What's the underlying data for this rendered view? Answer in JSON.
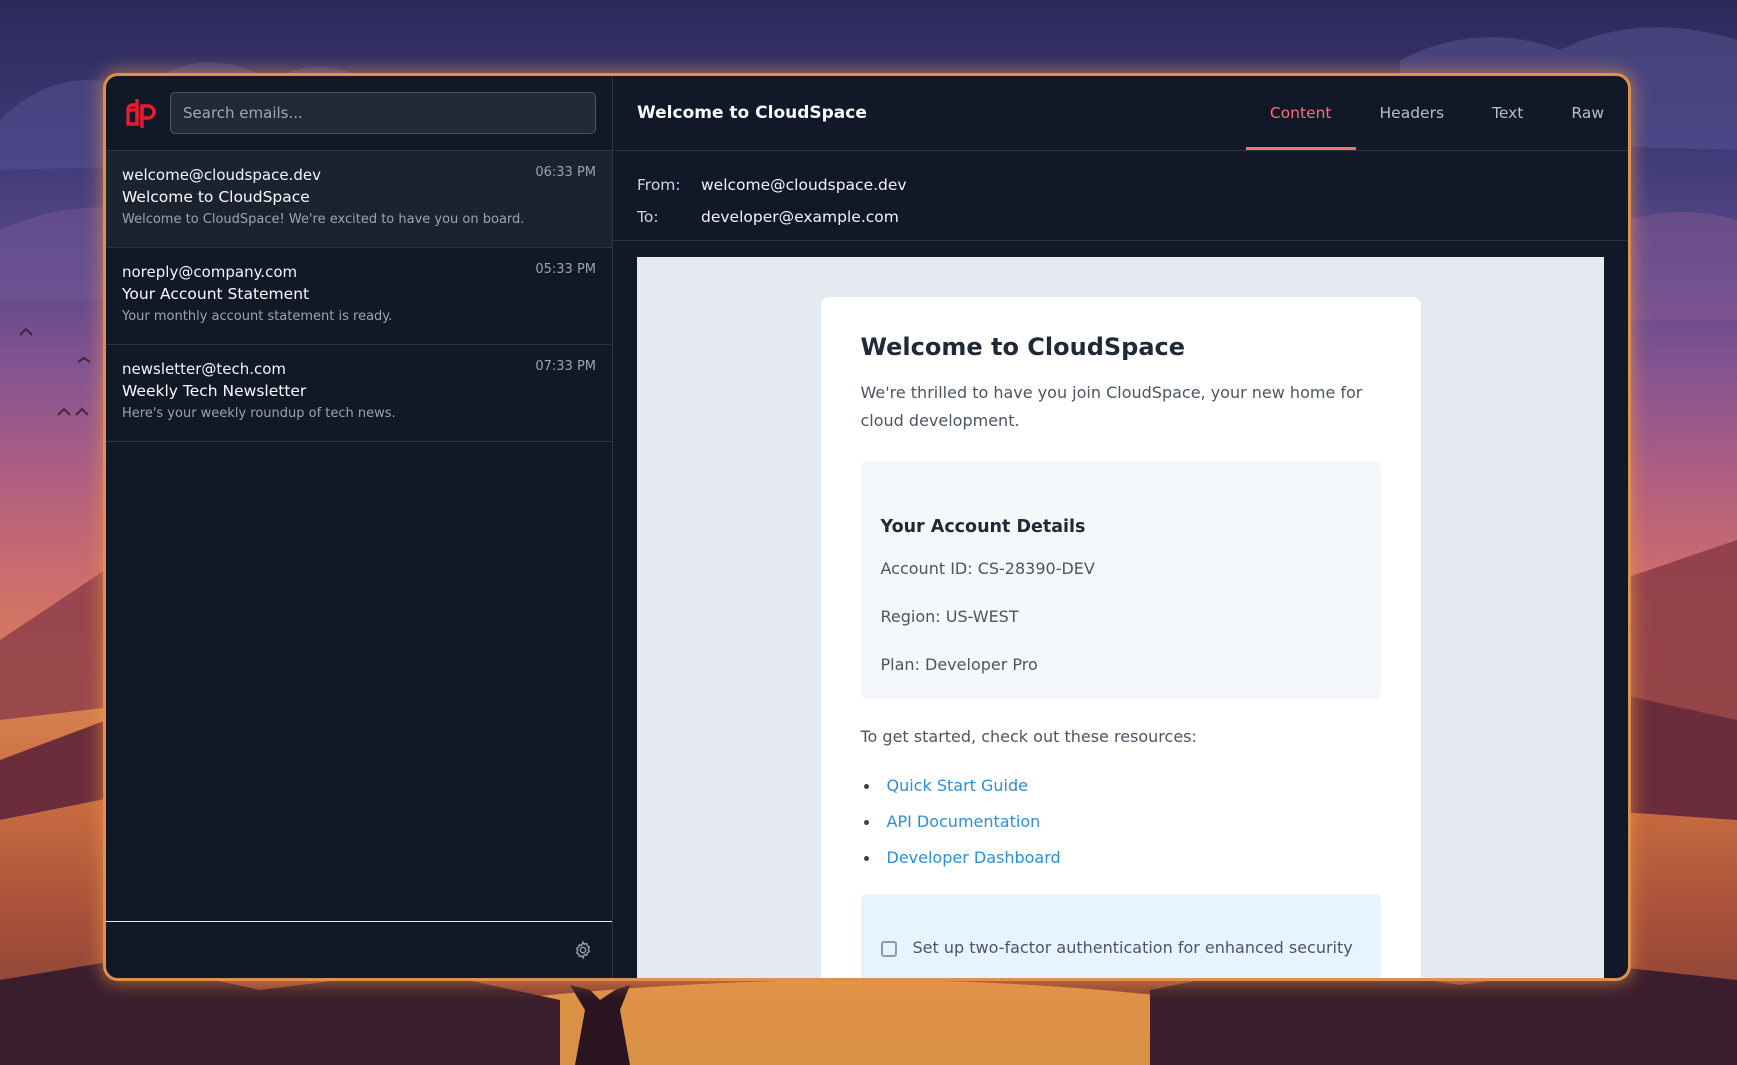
{
  "logo": {
    "text": "dp",
    "color": "#e11d2e"
  },
  "search": {
    "placeholder": "Search emails..."
  },
  "emails": [
    {
      "from": "welcome@cloudspace.dev",
      "time": "06:33 PM",
      "subject": "Welcome to CloudSpace",
      "preview": "Welcome to CloudSpace! We're excited to have you on board."
    },
    {
      "from": "noreply@company.com",
      "time": "05:33 PM",
      "subject": "Your Account Statement",
      "preview": "Your monthly account statement is ready."
    },
    {
      "from": "newsletter@tech.com",
      "time": "07:33 PM",
      "subject": "Weekly Tech Newsletter",
      "preview": "Here's your weekly roundup of tech news."
    }
  ],
  "message": {
    "title": "Welcome to CloudSpace",
    "from_label": "From:",
    "from": "welcome@cloudspace.dev",
    "to_label": "To:",
    "to": "developer@example.com"
  },
  "tabs": [
    {
      "label": "Content",
      "active": true
    },
    {
      "label": "Headers",
      "active": false
    },
    {
      "label": "Text",
      "active": false
    },
    {
      "label": "Raw",
      "active": false
    }
  ],
  "body": {
    "heading": "Welcome to CloudSpace",
    "intro": "We're thrilled to have you join CloudSpace, your new home for cloud development.",
    "details_title": "Your Account Details",
    "account_id": "Account ID: CS-28390-DEV",
    "region": "Region: US-WEST",
    "plan": "Plan: Developer Pro",
    "resources_intro": "To get started, check out these resources:",
    "links": [
      "Quick Start Guide",
      "API Documentation",
      "Developer Dashboard"
    ],
    "security_note": "Set up two-factor authentication for enhanced security"
  },
  "colors": {
    "accent": "#f87171",
    "link": "#2b8fd6",
    "window_glow": "#e0904a"
  },
  "icons": {
    "settings": "gear-icon",
    "logo": "dp-logo-icon"
  }
}
